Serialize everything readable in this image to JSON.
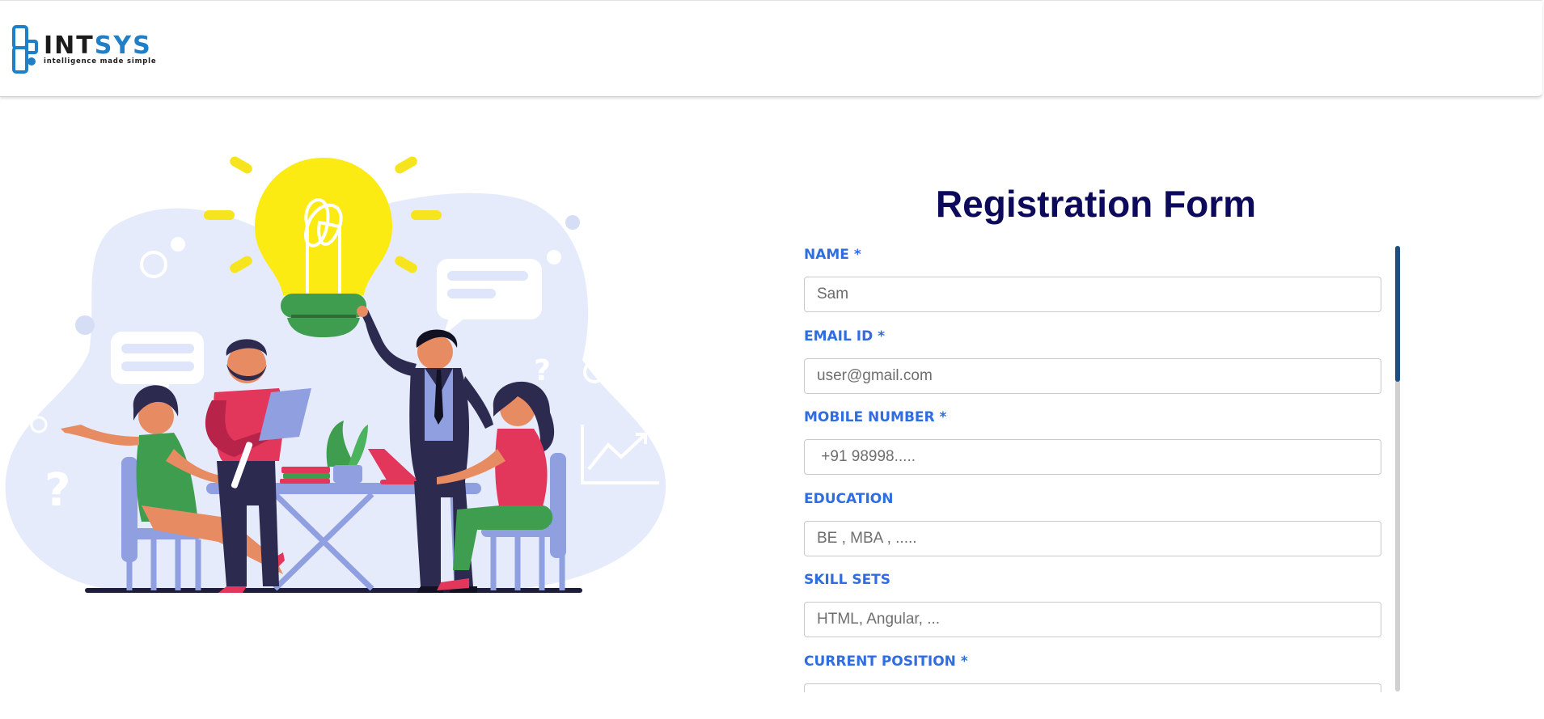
{
  "brand": {
    "mark_letters": "INT",
    "mark_accent": "SYS",
    "tagline": "intelligence made simple",
    "accent_color": "#1f7fc7"
  },
  "illustration": {
    "icons": [
      "lightbulb-icon",
      "question-mark-icon",
      "chart-up-icon"
    ]
  },
  "form": {
    "title": "Registration Form",
    "fields": [
      {
        "label": "NAME *",
        "value": "Sam",
        "placeholder": ""
      },
      {
        "label": "EMAIL ID *",
        "value": "",
        "placeholder": "user@gmail.com"
      },
      {
        "label": "MOBILE NUMBER *",
        "value": "",
        "placeholder": " +91 98998....."
      },
      {
        "label": "EDUCATION",
        "value": "",
        "placeholder": "BE , MBA , ....."
      },
      {
        "label": "SKILL SETS",
        "value": "",
        "placeholder": "HTML, Angular, ..."
      },
      {
        "label": "CURRENT POSITION *",
        "value": "",
        "placeholder": ""
      }
    ],
    "label_color": "#2f6de0",
    "title_color": "#0d0a5c"
  }
}
